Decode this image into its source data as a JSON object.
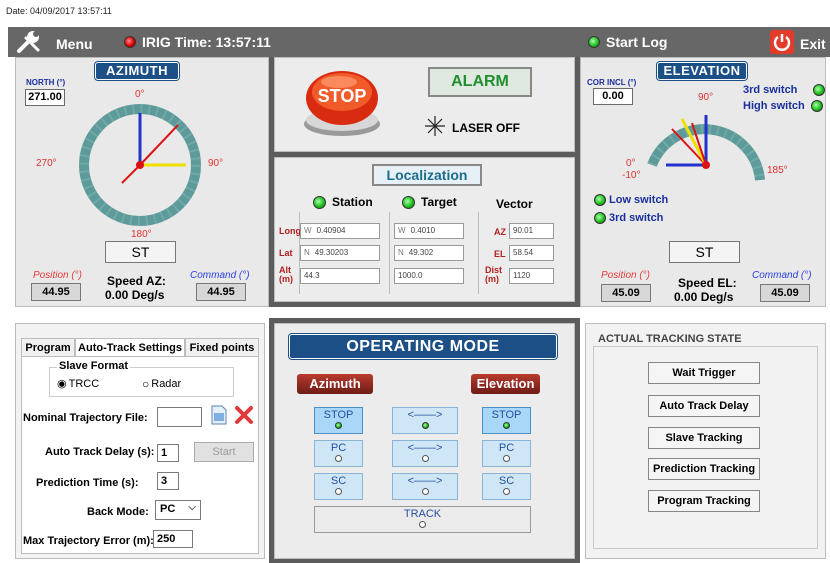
{
  "date_line": "Date: 04/09/2017 13:57:11",
  "topbar": {
    "menu_label": "Menu",
    "irig_label": "IRIG Time: 13:57:11",
    "start_log_label": "Start Log",
    "exit_label": "Exit"
  },
  "azimuth": {
    "title": "AZIMUTH",
    "north_label": "NORTH (°)",
    "north_value": "271.00",
    "ticks": {
      "top": "0°",
      "left": "270°",
      "right": "90°",
      "bottom": "180°"
    },
    "mode": "ST",
    "position_label": "Position (°)",
    "position_value": "44.95",
    "speed_label": "Speed AZ:",
    "speed_value": "0.00 Deg/s",
    "command_label": "Command (°)",
    "command_value": "44.95"
  },
  "elevation": {
    "title": "ELEVATION",
    "cor_label": "COR INCL (°)",
    "cor_value": "0.00",
    "ticks": {
      "top": "90°",
      "zero": "0°",
      "neg": "-10°",
      "right": "185°"
    },
    "switches_right": [
      "3rd switch",
      "High switch"
    ],
    "switches_left": [
      "Low switch",
      "3rd switch"
    ],
    "mode": "ST",
    "position_label": "Position (°)",
    "position_value": "45.09",
    "speed_label": "Speed EL:",
    "speed_value": "0.00 Deg/s",
    "command_label": "Command (°)",
    "command_value": "45.09"
  },
  "center_top": {
    "stop_label": "STOP",
    "alarm_label": "ALARM",
    "laser_label": "LASER OFF"
  },
  "localization": {
    "title": "Localization",
    "station_label": "Station",
    "target_label": "Target",
    "vector_label": "Vector",
    "row_labels": {
      "long": "Long",
      "lat": "Lat",
      "alt": "Alt (m)"
    },
    "station": {
      "long_dir": "W",
      "long": "0.40904",
      "lat_dir": "N",
      "lat": "49.30203",
      "alt": "44.3"
    },
    "target": {
      "long_dir": "W",
      "long": "0.4010",
      "lat_dir": "N",
      "lat": "49.302",
      "alt": "1000.0"
    },
    "vector": {
      "az_label": "AZ",
      "az": "90.01",
      "el_label": "EL",
      "el": "58.54",
      "dist_label": "Dist (m)",
      "dist": "1120"
    }
  },
  "settings": {
    "tabs": [
      "Program",
      "Auto-Track Settings",
      "Fixed points"
    ],
    "slave_format_label": "Slave Format",
    "radio_trcc": "TRCC",
    "radio_radar": "Radar",
    "nominal_file_label": "Nominal Trajectory File:",
    "nominal_file_value": "",
    "auto_track_delay_label": "Auto Track Delay (s):",
    "auto_track_delay_value": "1",
    "start_label": "Start",
    "prediction_time_label": "Prediction Time (s):",
    "prediction_time_value": "3",
    "back_mode_label": "Back Mode:",
    "back_mode_value": "PC",
    "max_error_label": "Max Trajectory Error (m):",
    "max_error_value": "250"
  },
  "operating_mode": {
    "title": "OPERATING MODE",
    "azimuth_label": "Azimuth",
    "elevation_label": "Elevation",
    "az_buttons": [
      "STOP",
      "PC",
      "SC"
    ],
    "el_buttons": [
      "STOP",
      "PC",
      "SC"
    ],
    "link_label": "<——>",
    "track_label": "TRACK"
  },
  "tracking_state": {
    "title": "ACTUAL TRACKING STATE",
    "buttons": [
      "Wait Trigger",
      "Auto Track Delay",
      "Slave Tracking",
      "Prediction Tracking",
      "Program Tracking"
    ]
  },
  "colors": {
    "heading_blue": "#1b4f86",
    "led_green": "#1fbf1f",
    "led_red": "#dd0000",
    "dial_teal": "#5d9a9a",
    "alarm_green": "#1f8f2f"
  }
}
